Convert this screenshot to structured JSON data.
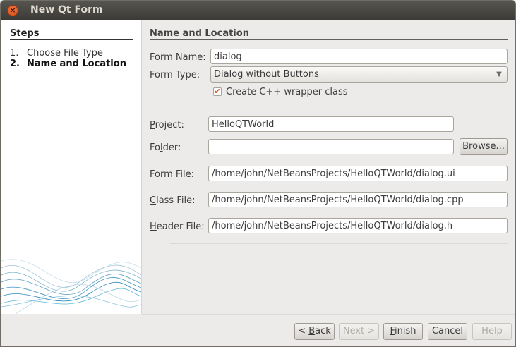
{
  "window": {
    "title": "New Qt Form",
    "close_glyph": "×"
  },
  "sidebar": {
    "title": "Steps",
    "steps": [
      {
        "num": "1.",
        "label": "Choose File Type"
      },
      {
        "num": "2.",
        "label": "Name and Location"
      }
    ]
  },
  "main": {
    "section_title": "Name and Location",
    "form_name_label": "Form Name:",
    "form_name_value": "dialog",
    "form_type_label": "Form Type:",
    "form_type_value": "Dialog without Buttons",
    "wrapper_checkbox_label": "Create C++ wrapper class",
    "wrapper_checked": true,
    "project_label": "Project:",
    "project_value": "HelloQTWorld",
    "folder_label": "Folder:",
    "folder_value": "",
    "browse_label": "Browse...",
    "form_file_label": "Form File:",
    "form_file_value": "/home/john/NetBeansProjects/HelloQTWorld/dialog.ui",
    "class_file_label": "Class File:",
    "class_file_value": "/home/john/NetBeansProjects/HelloQTWorld/dialog.cpp",
    "header_file_label": "Header File:",
    "header_file_value": "/home/john/NetBeansProjects/HelloQTWorld/dialog.h"
  },
  "buttons": {
    "back": "< Back",
    "next": "Next >",
    "finish": "Finish",
    "cancel": "Cancel",
    "help": "Help"
  },
  "colors": {
    "accent": "#d9470e",
    "titlebar": "#3c3b37"
  }
}
